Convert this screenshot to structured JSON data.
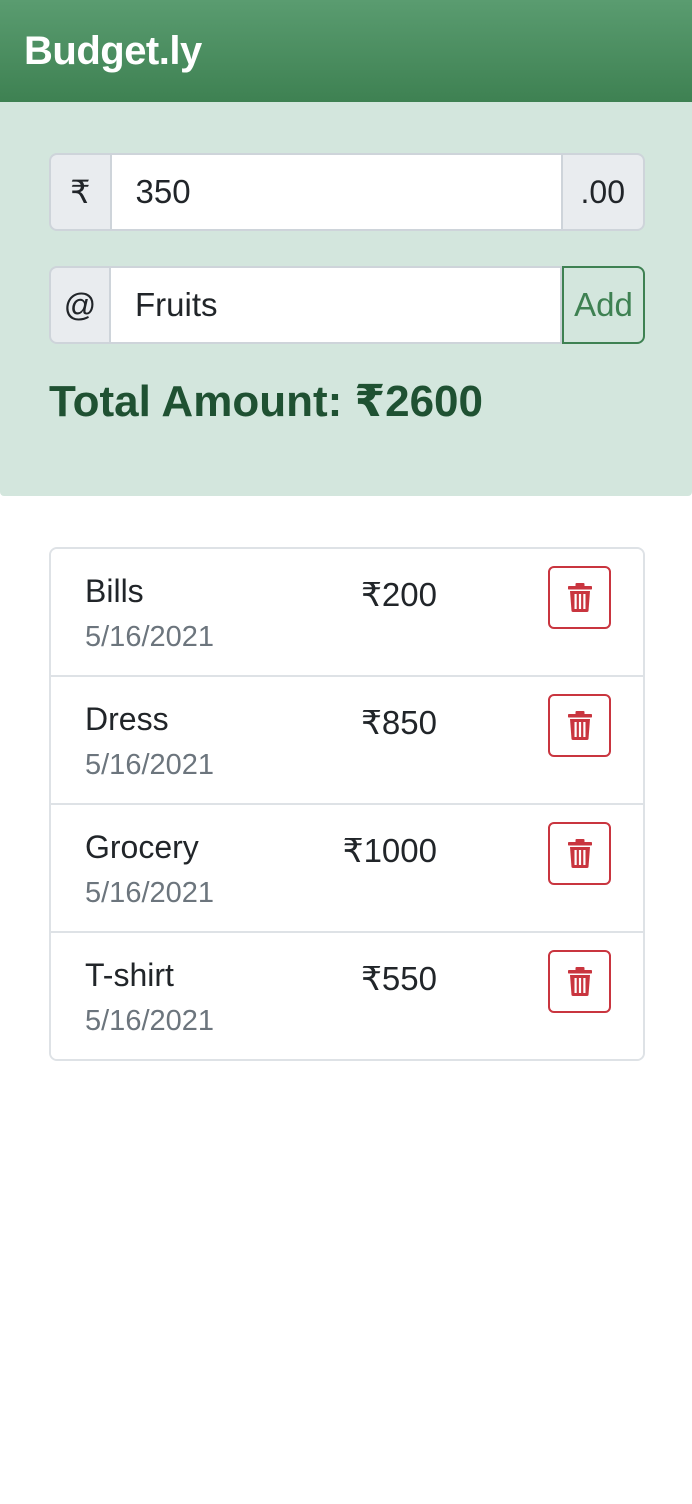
{
  "app": {
    "title": "Budget.ly"
  },
  "form": {
    "currency_symbol": "₹",
    "amount_value": "350",
    "amount_suffix": ".00",
    "desc_prefix": "@",
    "desc_value": "Fruits",
    "add_label": "Add"
  },
  "total": {
    "label": "Total Amount: ₹2600"
  },
  "colors": {
    "brand_green": "#3e8152",
    "panel_bg": "#d3e6dd",
    "danger": "#c9353f"
  },
  "expenses": [
    {
      "name": "Bills",
      "date": "5/16/2021",
      "amount": "₹200",
      "delete_icon": "trash-icon"
    },
    {
      "name": "Dress",
      "date": "5/16/2021",
      "amount": "₹850",
      "delete_icon": "trash-icon"
    },
    {
      "name": "Grocery",
      "date": "5/16/2021",
      "amount": "₹1000",
      "delete_icon": "trash-icon"
    },
    {
      "name": "T-shirt",
      "date": "5/16/2021",
      "amount": "₹550",
      "delete_icon": "trash-icon"
    }
  ]
}
